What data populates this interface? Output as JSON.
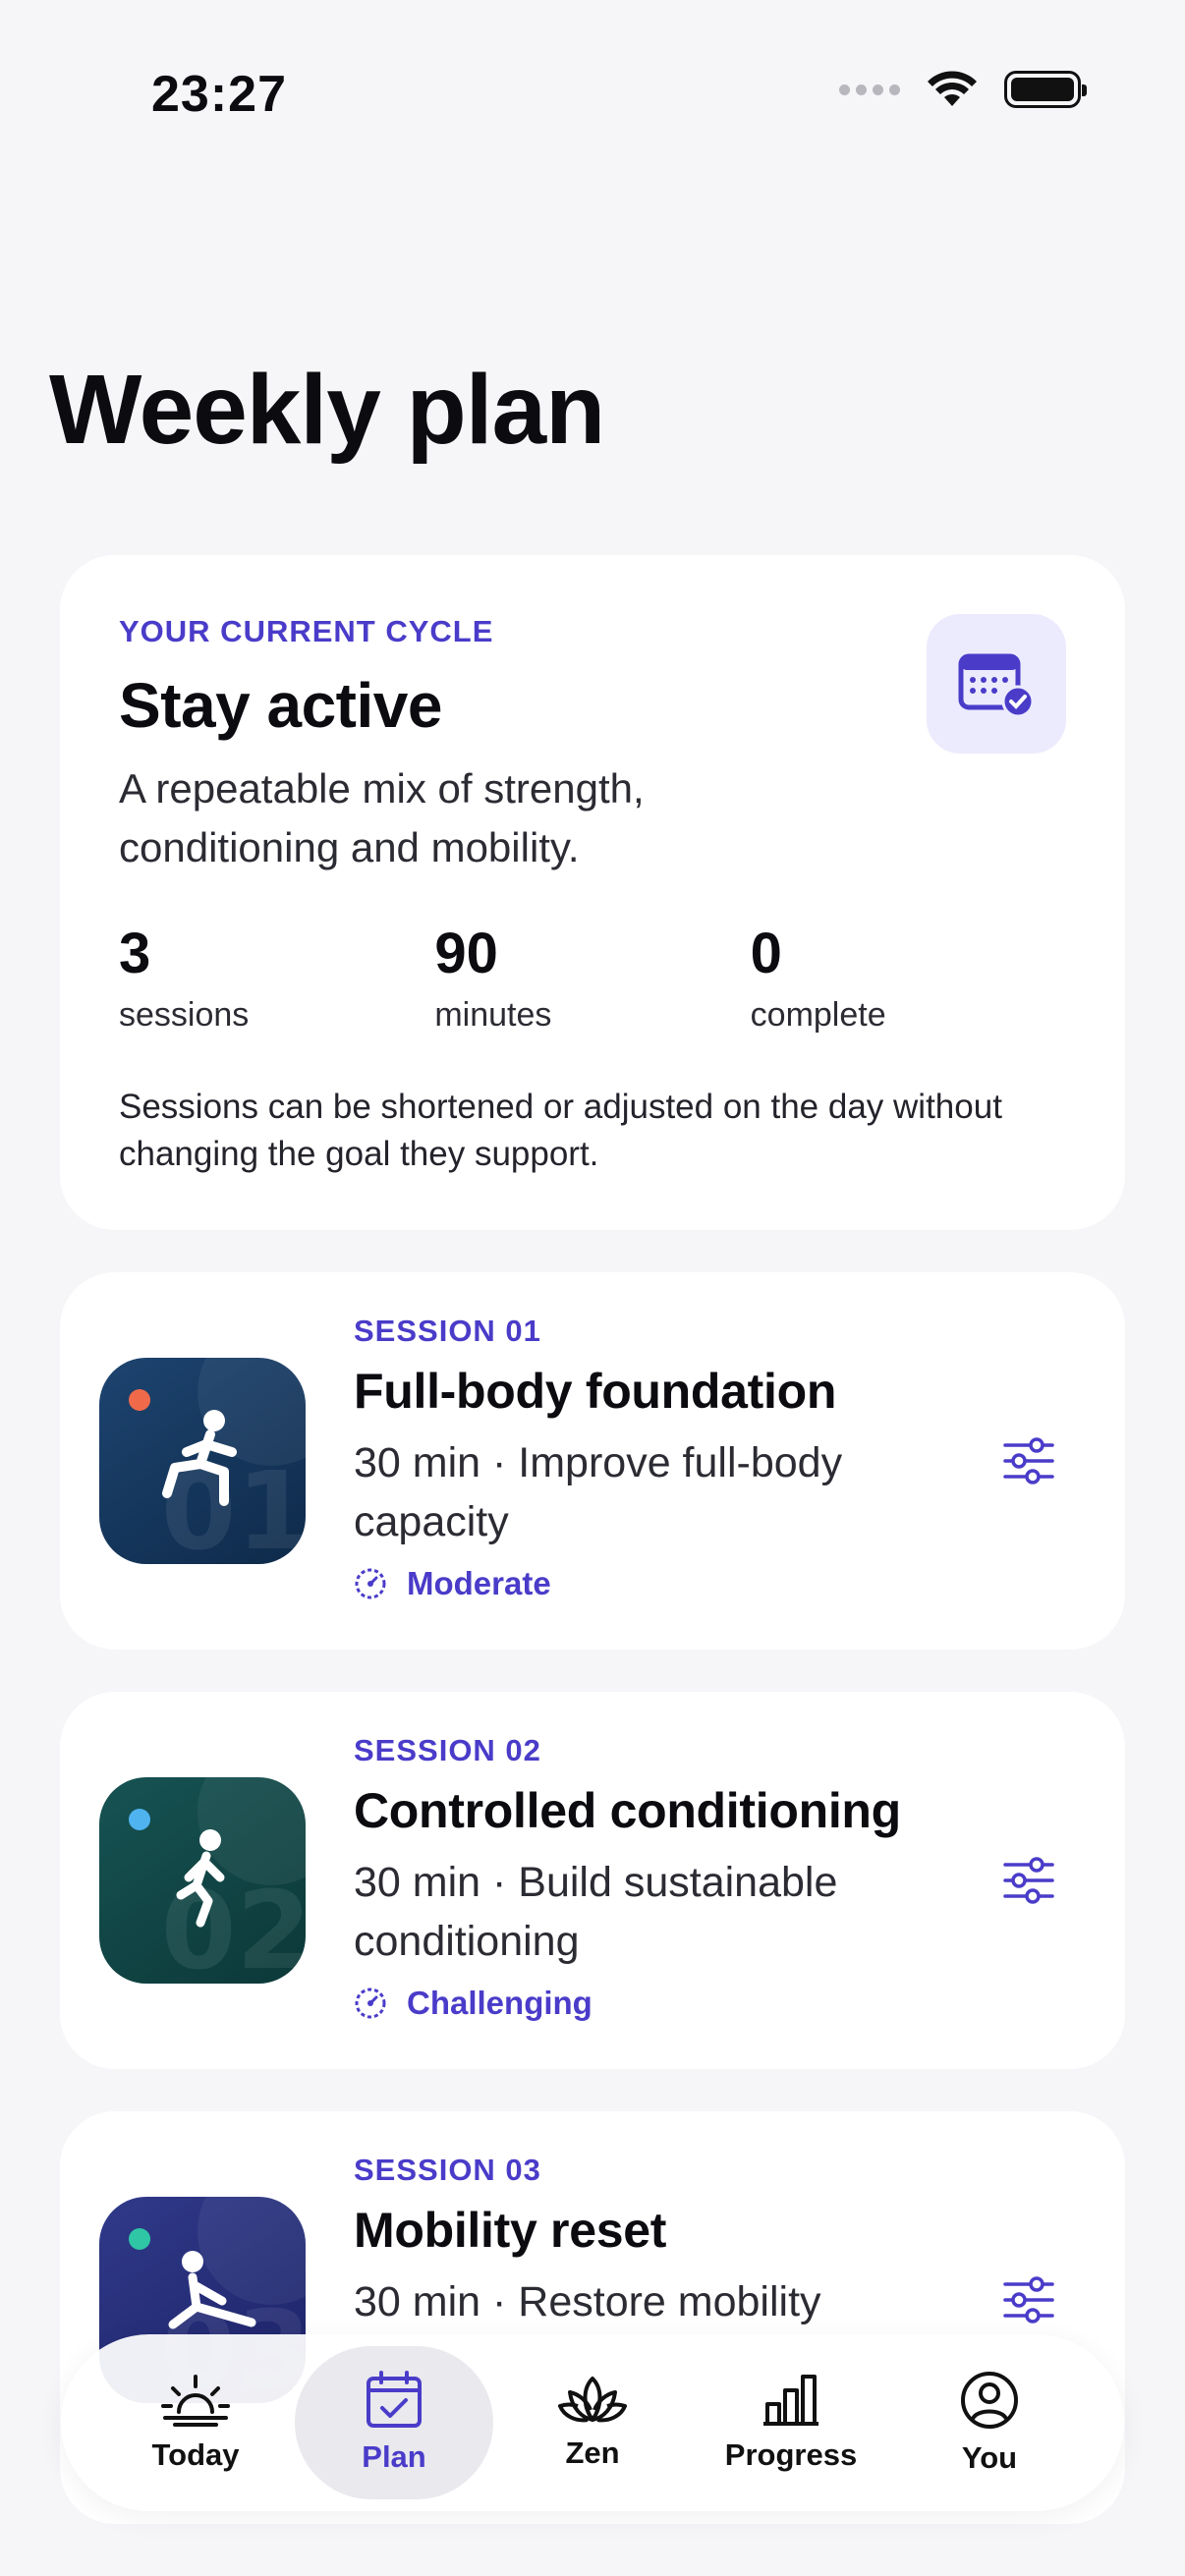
{
  "status": {
    "time": "23:27"
  },
  "page": {
    "title": "Weekly plan"
  },
  "cycle": {
    "eyebrow": "YOUR CURRENT CYCLE",
    "title": "Stay active",
    "description": "A repeatable mix of strength, conditioning and mobility.",
    "stats": [
      {
        "value": "3",
        "label": "sessions"
      },
      {
        "value": "90",
        "label": "minutes"
      },
      {
        "value": "0",
        "label": "complete"
      }
    ],
    "note": "Sessions can be shortened or adjusted on the day without changing the goal they support.",
    "icon": "calendar-check-icon"
  },
  "sessions": [
    {
      "eyebrow": "SESSION 01",
      "number": "01",
      "title": "Full-body foundation",
      "description": "30 min · Improve full-body capacity",
      "intensity": "Moderate",
      "accent": "#f06a4a",
      "icon": "lunge-figure-icon"
    },
    {
      "eyebrow": "SESSION 02",
      "number": "02",
      "title": "Controlled conditioning",
      "description": "30 min · Build sustainable conditioning",
      "intensity": "Challenging",
      "accent": "#4fb3f0",
      "icon": "running-figure-icon"
    },
    {
      "eyebrow": "SESSION 03",
      "number": "03",
      "title": "Mobility reset",
      "description": "30 min · Restore mobility",
      "accent": "#2fc6a6",
      "icon": "stretch-figure-icon"
    }
  ],
  "tabs": [
    {
      "label": "Today",
      "icon": "sunrise-icon"
    },
    {
      "label": "Plan",
      "icon": "calendar-check-icon",
      "active": true
    },
    {
      "label": "Zen",
      "icon": "lotus-icon"
    },
    {
      "label": "Progress",
      "icon": "bar-chart-icon"
    },
    {
      "label": "You",
      "icon": "profile-icon"
    }
  ],
  "colors": {
    "accent": "#4a3cc9",
    "background": "#f6f6f9"
  }
}
